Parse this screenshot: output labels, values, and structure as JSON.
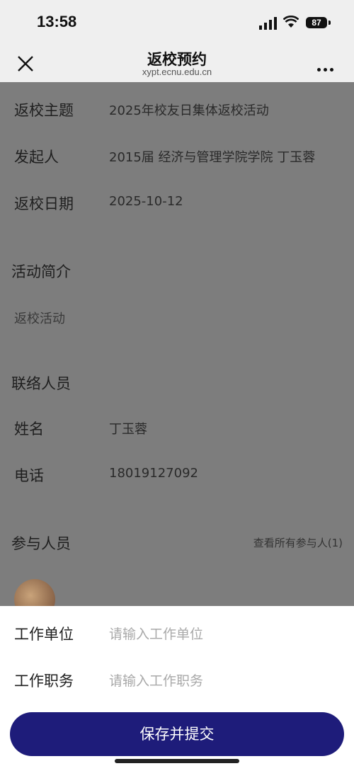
{
  "status_bar": {
    "time": "13:58",
    "battery": "87"
  },
  "nav": {
    "title": "返校预约",
    "subtitle": "xypt.ecnu.edu.cn"
  },
  "details": [
    {
      "label": "返校主题",
      "value": "2025年校友日集体返校活动"
    },
    {
      "label": "发起人",
      "value": "2015届 经济与管理学院学院 丁玉蓉"
    },
    {
      "label": "返校日期",
      "value": "2025-10-12"
    }
  ],
  "intro": {
    "title": "活动简介",
    "text": "返校活动"
  },
  "contact": {
    "title": "联络人员",
    "name_label": "姓名",
    "name_value": "丁玉蓉",
    "phone_label": "电话",
    "phone_value": "18019127092"
  },
  "participants": {
    "title": "参与人员",
    "view_all": "查看所有参与人(1)"
  },
  "form": {
    "work_unit_label": "工作单位",
    "work_unit_placeholder": "请输入工作单位",
    "position_label": "工作职务",
    "position_placeholder": "请输入工作职务",
    "submit_label": "保存并提交"
  },
  "colors": {
    "overlay": "#7d7d7d",
    "primary": "#1e1c7a",
    "sheet": "#ffffff"
  }
}
